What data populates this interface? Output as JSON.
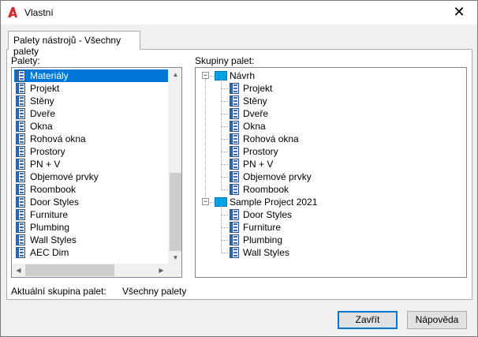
{
  "window": {
    "title": "Vlastní",
    "close_glyph": "✕"
  },
  "tab": {
    "label": "Palety nástrojů - Všechny palety"
  },
  "palettes": {
    "label": "Palety:",
    "items": [
      "Materiály",
      "Projekt",
      "Stěny",
      "Dveře",
      "Okna",
      "Rohová okna",
      "Prostory",
      "PN + V",
      "Objemové prvky",
      "Roombook",
      "Door Styles",
      "Furniture",
      "Plumbing",
      "Wall Styles",
      "AEC Dim"
    ],
    "selected_index": 0
  },
  "groups": {
    "label": "Skupiny palet:",
    "tree": [
      {
        "name": "Návrh",
        "expanded": true,
        "children": [
          "Projekt",
          "Stěny",
          "Dveře",
          "Okna",
          "Rohová okna",
          "Prostory",
          "PN + V",
          "Objemové prvky",
          "Roombook"
        ]
      },
      {
        "name": "Sample Project 2021",
        "expanded": true,
        "children": [
          "Door Styles",
          "Furniture",
          "Plumbing",
          "Wall Styles"
        ]
      }
    ]
  },
  "current_group": {
    "label": "Aktuální skupina palet:",
    "value": "Všechny palety"
  },
  "buttons": {
    "close": "Zavřít",
    "help": "Nápověda"
  },
  "colors": {
    "accent": "#0078d7",
    "selection": "#0078d7",
    "group_icon": "#00a2e8",
    "app_icon": "#d9262b"
  },
  "icons": {
    "app": "autocad-logo-icon",
    "palette": "tool-palette-icon",
    "group": "palette-group-icon"
  }
}
